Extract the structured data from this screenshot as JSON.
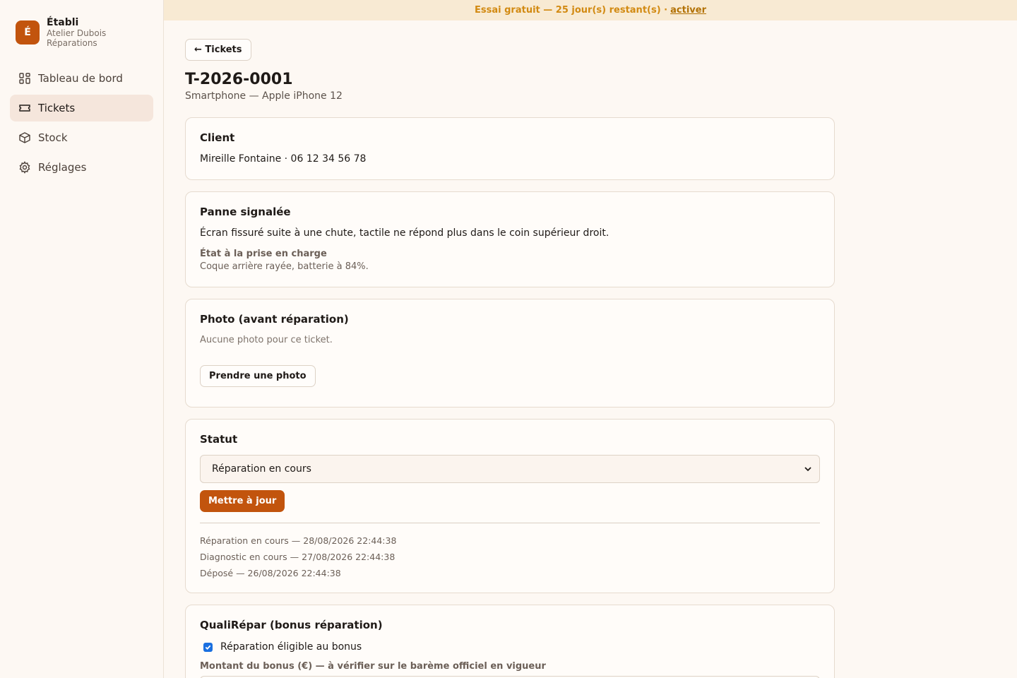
{
  "brand": {
    "logo_letter": "É",
    "name": "Établi",
    "subtitle": "Atelier Dubois Réparations"
  },
  "nav": {
    "items": [
      {
        "label": "Tableau de bord",
        "icon": "dashboard-icon"
      },
      {
        "label": "Tickets",
        "icon": "ticket-icon",
        "active": true
      },
      {
        "label": "Stock",
        "icon": "box-icon"
      },
      {
        "label": "Réglages",
        "icon": "gear-icon"
      }
    ]
  },
  "banner": {
    "text": "Essai gratuit — 25 jour(s) restant(s) ·",
    "link": "activer"
  },
  "header": {
    "back_label": "← Tickets",
    "title": "T-2026-0001",
    "subtitle": "Smartphone — Apple iPhone 12"
  },
  "client": {
    "heading": "Client",
    "info": "Mireille Fontaine · 06 12 34 56 78"
  },
  "panne": {
    "heading": "Panne signalée",
    "description": "Écran fissuré suite à une chute, tactile ne répond plus dans le coin supérieur droit.",
    "state_label": "État à la prise en charge",
    "state_text": "Coque arrière rayée, batterie à 84%."
  },
  "photo": {
    "heading": "Photo (avant réparation)",
    "empty_text": "Aucune photo pour ce ticket.",
    "button_label": "Prendre une photo"
  },
  "statut": {
    "heading": "Statut",
    "selected": "Réparation en cours",
    "update_label": "Mettre à jour",
    "history": [
      "Réparation en cours — 28/08/2026 22:44:38",
      "Diagnostic en cours — 27/08/2026 22:44:38",
      "Déposé — 26/08/2026 22:44:38"
    ]
  },
  "bonus": {
    "heading": "QualiRépar (bonus réparation)",
    "checkbox_label": "Réparation éligible au bonus",
    "checked": true,
    "amount_label": "Montant du bonus (€) — à vérifier sur le barème officiel en vigueur"
  },
  "colors": {
    "accent": "#c2540d",
    "banner_bg": "#f8ead3",
    "banner_text": "#d28a12",
    "background": "#fdf8f3"
  }
}
